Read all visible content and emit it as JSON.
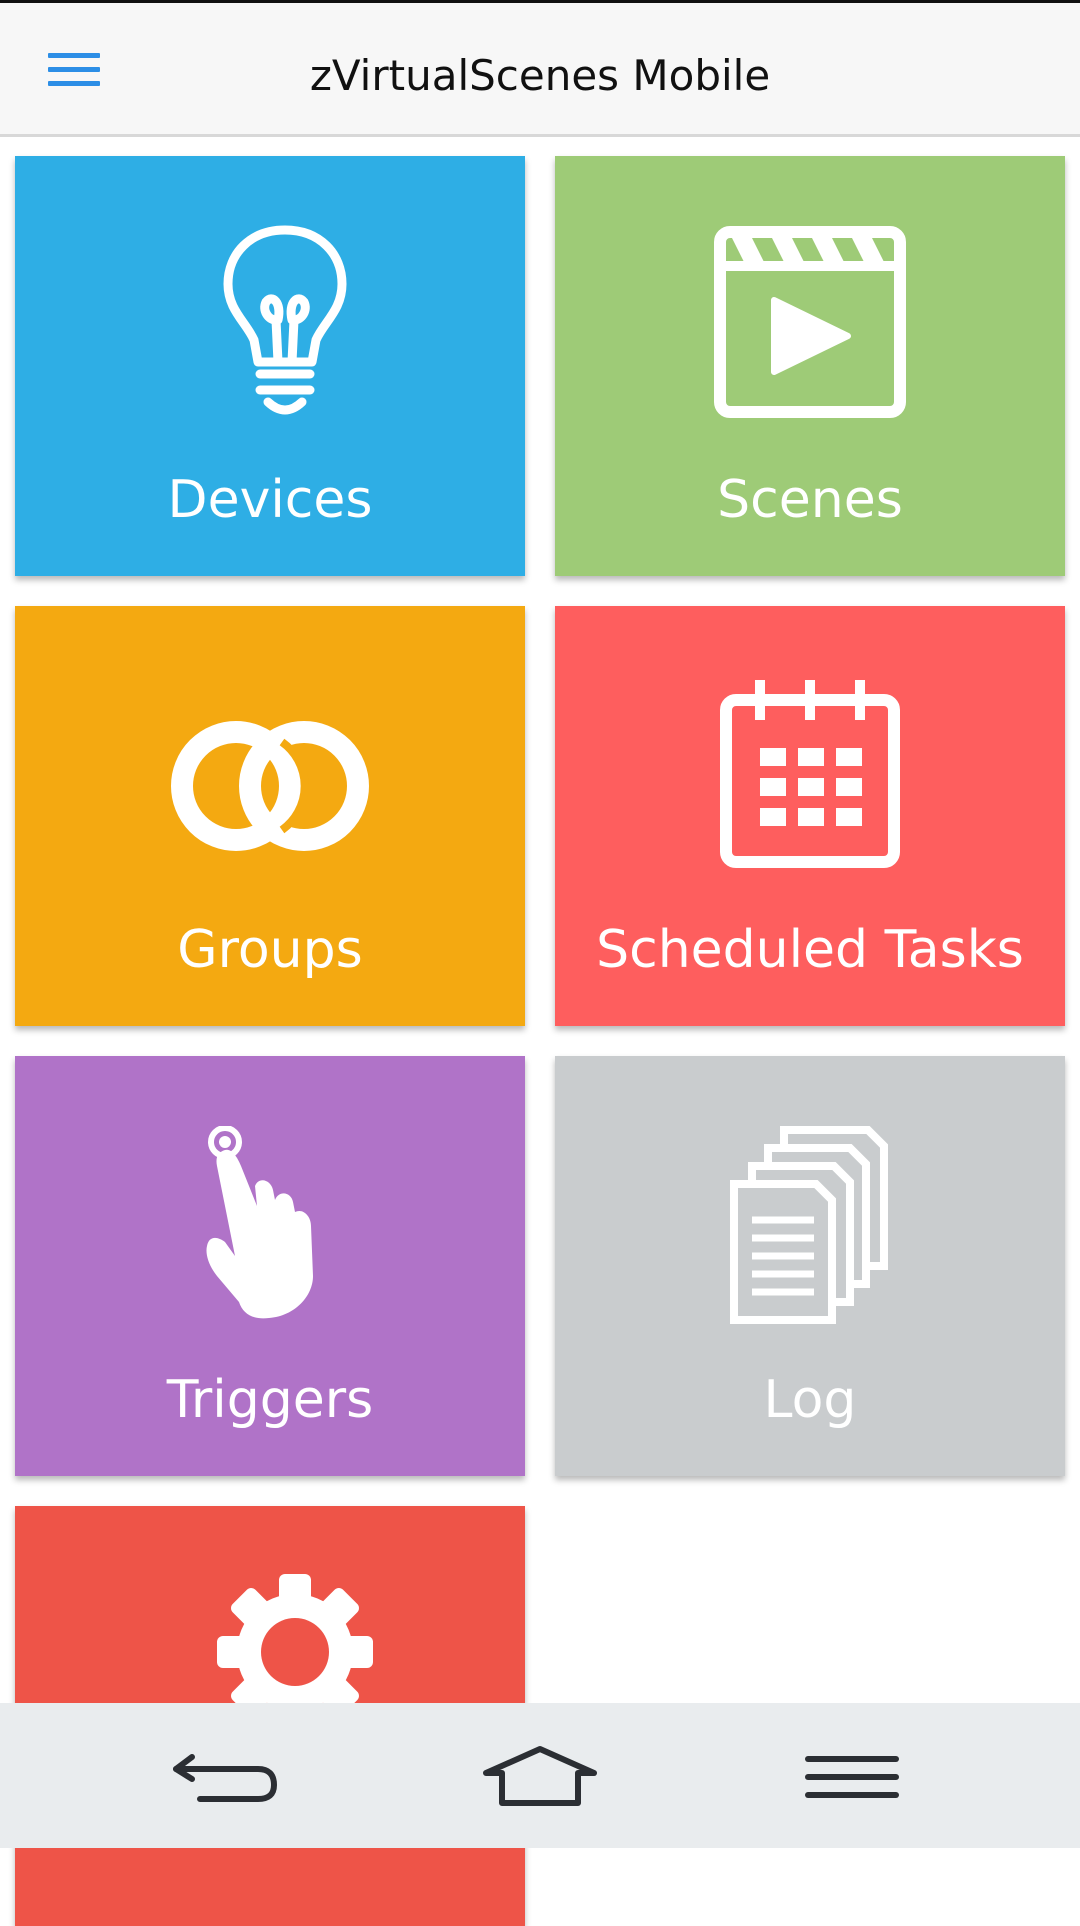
{
  "appbar": {
    "title": "zVirtualScenes Mobile",
    "menu_icon": "hamburger-menu-icon"
  },
  "tiles": [
    {
      "label": "Devices",
      "color": "#2eaee5",
      "icon": "lightbulb-icon"
    },
    {
      "label": "Scenes",
      "color": "#9ecb77",
      "icon": "clapperboard-icon"
    },
    {
      "label": "Groups",
      "color": "#f4a911",
      "icon": "linked-rings-icon"
    },
    {
      "label": "Scheduled Tasks",
      "color": "#fe5e5e",
      "icon": "calendar-icon"
    },
    {
      "label": "Triggers",
      "color": "#b073c8",
      "icon": "tap-hand-icon"
    },
    {
      "label": "Log",
      "color": "#c9ccce",
      "icon": "documents-icon"
    },
    {
      "label": "",
      "color": "#ee5448",
      "icon": "gears-icon"
    }
  ],
  "navbar": {
    "back_icon": "back-icon",
    "home_icon": "home-icon",
    "menu_icon": "menu-icon",
    "color": "#e9ecee"
  }
}
